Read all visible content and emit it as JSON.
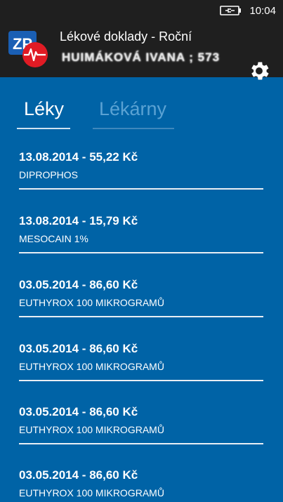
{
  "status_bar": {
    "time": "10:04",
    "battery_icon": "battery-charging-icon"
  },
  "header": {
    "title": "Lékové doklady - Roční",
    "subtitle": "HUIMÁKOVÁ IVANA ; 573",
    "logo_text": "ZP",
    "settings_icon": "gear-icon"
  },
  "tabs": [
    {
      "label": "Léky",
      "active": true
    },
    {
      "label": "Lékárny",
      "active": false
    }
  ],
  "items": [
    {
      "title": "13.08.2014 - 55,22 Kč",
      "subtitle": "DIPROPHOS"
    },
    {
      "title": "13.08.2014 - 15,79 Kč",
      "subtitle": "MESOCAIN 1%"
    },
    {
      "title": "03.05.2014 - 86,60 Kč",
      "subtitle": "EUTHYROX 100 MIKROGRAMŮ"
    },
    {
      "title": "03.05.2014 - 86,60 Kč",
      "subtitle": "EUTHYROX 100 MIKROGRAMŮ"
    },
    {
      "title": "03.05.2014 - 86,60 Kč",
      "subtitle": "EUTHYROX 100 MIKROGRAMŮ"
    },
    {
      "title": "03.05.2014 - 86,60 Kč",
      "subtitle": "EUTHYROX 100 MIKROGRAMŮ"
    }
  ],
  "colors": {
    "background": "#0063a6",
    "header": "#1f1f1f",
    "logo_blue": "#1a5fb4",
    "logo_red": "#e01b24",
    "tab_inactive": "#5aa2d3"
  }
}
